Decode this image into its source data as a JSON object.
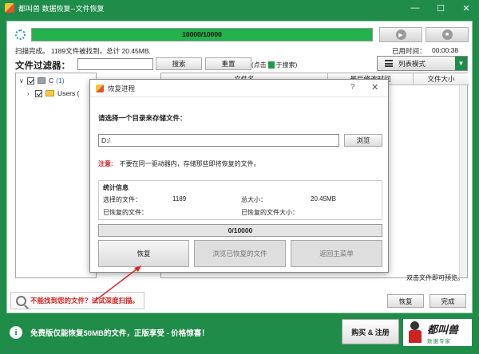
{
  "window": {
    "title": "都叫兽 数据恢复--文件恢复",
    "controls": [
      "—",
      "☐",
      "✕"
    ]
  },
  "scan": {
    "progress_text": "10000/10000",
    "progress_fraction": 1.0,
    "status": "扫描完成。 1189文件被找到。总计 20.45MB.",
    "elapsed_label": "已用时间：",
    "elapsed_value": "00:00:38"
  },
  "filter": {
    "label": "文件过滤器：",
    "input_value": "",
    "search_btn": "搜索",
    "reset_btn": "重置",
    "hint_prefix": "(点击",
    "hint_suffix": "于搜索)",
    "list_mode": "列表模式"
  },
  "tree": {
    "drive": {
      "label": "C",
      "count": "(1)"
    },
    "users_label": "Users ("
  },
  "file_list": {
    "columns": [
      "文件名",
      "最后修改时间",
      "文件大小"
    ]
  },
  "preview_hint": "双击文件即可预览。",
  "deep_scan": "不能找到您的文件？试试深度扫描。",
  "footer_btns": {
    "recover": "恢复",
    "finish": "完成"
  },
  "promo": {
    "text": "免费版仅能恢复50MB的文件，正版享受 - 价格惊喜！",
    "buy_btn": "购买 & 注册",
    "logo_line1": "都叫兽",
    "logo_line2": "数据专家"
  },
  "dialog": {
    "title": "恢复进程",
    "help": "?",
    "close": "✕",
    "choose_dir_label": "请选择一个目录来存储文件：",
    "path_value": "D:/",
    "browse_btn": "浏览",
    "note_label": "注意:",
    "note_text": "不要在同一驱动器内，存储那些即将恢复的文件。",
    "stats_title": "统计信息",
    "selected_files_label": "选择的文件：",
    "selected_files_value": "1189",
    "total_size_label": "总大小：",
    "total_size_value": "20.45MB",
    "recovered_files_label": "已恢复的文件：",
    "recovered_size_label": "已恢复的文件大小：",
    "progress_text": "0/10000",
    "recover_btn": "恢复",
    "browse_recovered_btn": "浏览已恢复的文件",
    "back_btn": "返回主菜单"
  }
}
